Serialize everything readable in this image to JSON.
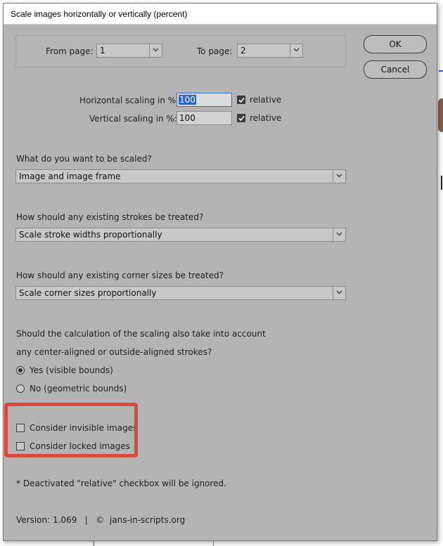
{
  "dialog": {
    "title": "Scale images horizontally or vertically (percent)"
  },
  "pages": {
    "from_label": "From page:",
    "from_value": "1",
    "to_label": "To page:",
    "to_value": "2"
  },
  "buttons": {
    "ok": "OK",
    "cancel": "Cancel"
  },
  "scaling": {
    "horizontal_label": "Horizontal scaling in %:",
    "horizontal_value": "100",
    "horizontal_relative_label": "relative",
    "horizontal_relative_checked": true,
    "vertical_label": "Vertical scaling in %:",
    "vertical_value": "100",
    "vertical_relative_label": "relative",
    "vertical_relative_checked": true
  },
  "what_scaled": {
    "question": "What do you want to be scaled?",
    "selected": "Image and image frame"
  },
  "strokes": {
    "question": "How should any existing strokes be treated?",
    "selected": "Scale stroke widths proportionally"
  },
  "corners": {
    "question": "How should any existing corner sizes be treated?",
    "selected": "Scale corner sizes proportionally"
  },
  "bounds": {
    "question_line1": "Should the calculation of the scaling also take into account",
    "question_line2": "any center-aligned or outside-aligned strokes?",
    "yes_label": "Yes  (visible bounds)",
    "no_label": "No  (geometric bounds)",
    "selected": "yes"
  },
  "options": {
    "invisible_label": "Consider invisible images",
    "invisible_checked": false,
    "locked_label": "Consider locked images",
    "locked_checked": false
  },
  "footer": {
    "note": "* Deactivated \"relative\" checkbox will be ignored.",
    "version": "Version: 1.069   |   ©  jans-in-scripts.org"
  },
  "colors": {
    "dialog_bg": "#b4b4b4",
    "highlight": "#d94a3a",
    "selection": "#2d63c8"
  }
}
